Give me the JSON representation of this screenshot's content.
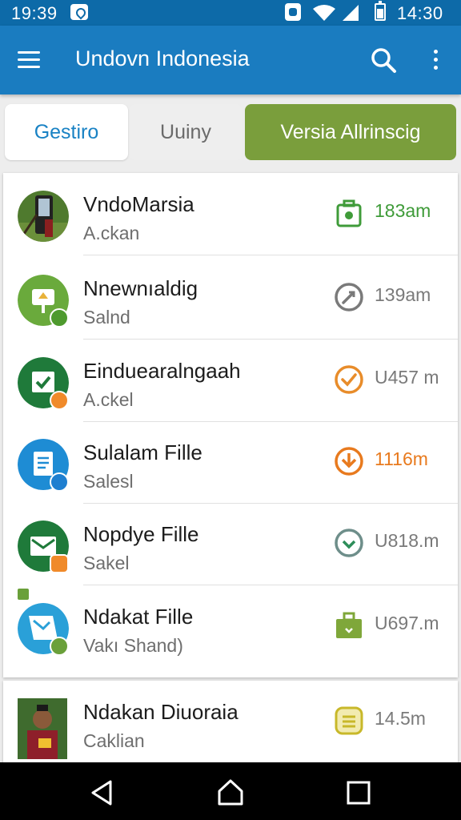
{
  "status_bar": {
    "time_left": "19:39",
    "time_right": "14:30"
  },
  "app_bar": {
    "title": "Undovn Indonesia",
    "icons": [
      "menu-icon",
      "search-icon",
      "more-vert-icon"
    ]
  },
  "tabs": [
    {
      "label": "Gestiro"
    },
    {
      "label": "Uuiny"
    },
    {
      "label": "Versia  Allrinscig"
    }
  ],
  "list": {
    "items": [
      {
        "name": "VndoMarsia",
        "sub": "A.ckan",
        "time": "183am",
        "status_icon": "briefcase-download-icon",
        "color": "#3f9b39"
      },
      {
        "name": "Nnewnıaldig",
        "sub": "Salnd",
        "time": "139am",
        "status_icon": "clock-icon",
        "color": "#7a7a7a"
      },
      {
        "name": "Einduearalngaah",
        "sub": "A.ckel",
        "time": "U457 m",
        "status_icon": "check-circle-icon",
        "color": "#e88c2a"
      },
      {
        "name": "Sulalam Fille",
        "sub": "Salesl",
        "time": "1116m",
        "status_icon": "download-circle-icon",
        "color": "#e87a1e"
      },
      {
        "name": "Nopdye Fille",
        "sub": "Sakel",
        "time": "U818.m",
        "status_icon": "check-circle-icon",
        "color": "#6e8e8a"
      },
      {
        "name": "Ndakat Fille",
        "sub": "Vakı Shand)",
        "time": "U697.m",
        "status_icon": "briefcase-icon",
        "color": "#7fa73a"
      },
      {
        "name": "Ndakan Diuoraia",
        "sub": "Caklian",
        "time": "14.5m",
        "status_icon": "notes-icon",
        "color": "#c8b82a"
      }
    ]
  },
  "nav_bar": {
    "icons": [
      "back-icon",
      "home-icon",
      "recents-icon"
    ]
  },
  "colors": {
    "status_bar": "#0d6aa8",
    "app_bar": "#1a7cc0",
    "tab_active_text": "#1982c4",
    "tab_accent": "#7a9e3c"
  }
}
